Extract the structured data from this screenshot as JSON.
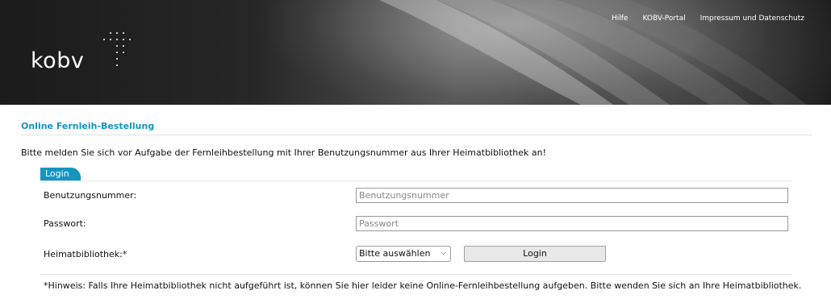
{
  "header": {
    "logo_text": "kobv",
    "nav": [
      "Hilfe",
      "KOBV-Portal",
      "Impressum und Datenschutz"
    ]
  },
  "page_title": "Online Fernleih-Bestellung",
  "intro_text": "Bitte melden Sie sich vor Aufgabe der Fernleihbestellung mit Ihrer Benutzungsnummer aus Ihrer Heimatbibliothek an!",
  "login": {
    "tab_label": "Login",
    "user_label": "Benutzungsnummer:",
    "user_placeholder": "Benutzungsnummer",
    "password_label": "Passwort:",
    "password_placeholder": "Passwort",
    "library_label": "Heimatbibliothek:*",
    "library_selected": "Bitte auswählen",
    "submit_label": "Login"
  },
  "hint": "*Hinweis: Falls Ihre Heimatbibliothek nicht aufgeführt ist, können Sie hier leider keine Online-Fernleihbestellung aufgeben. Bitte wenden Sie sich an Ihre Heimatbibliothek.",
  "colors": {
    "accent": "#1495c0"
  }
}
